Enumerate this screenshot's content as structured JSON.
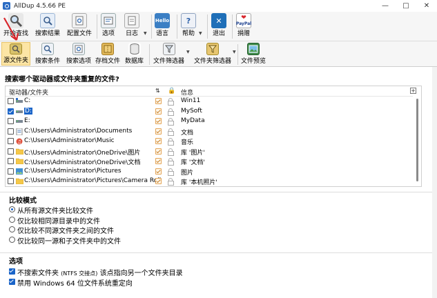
{
  "window": {
    "title": "AllDup 4.5.66 PE"
  },
  "toolbar1": {
    "start_search": "开始查找",
    "search_results": "搜索结果",
    "config_file": "配置文件",
    "options": "选项",
    "log": "日志",
    "language": "语言",
    "help": "帮助",
    "exit": "退出",
    "donate": "捐赠",
    "language_icon_text": "Hello",
    "donate_icon_text": "PayPal"
  },
  "toolbar2": {
    "source_folder": "源文件夹",
    "search_criteria": "搜索条件",
    "search_options": "搜索选项",
    "archive_files": "存档文件",
    "database": "数据库",
    "file_filter": "文件筛选器",
    "folder_filter": "文件夹筛选器",
    "file_preview": "文件预览"
  },
  "source": {
    "question": "搜索哪个驱动器或文件夹重复的文件?",
    "col_path": "驱动器/文件夹",
    "col_info": "信息",
    "rows": [
      {
        "path": "C:",
        "info": "Win11",
        "checked": false,
        "selected": false
      },
      {
        "path": "D:",
        "info": "MySoft",
        "checked": true,
        "selected": true
      },
      {
        "path": "E:",
        "info": "MyData",
        "checked": false,
        "selected": false
      },
      {
        "path": "C:\\Users\\Administrator\\Documents",
        "info": "文档",
        "checked": false,
        "selected": false
      },
      {
        "path": "C:\\Users\\Administrator\\Music",
        "info": "音乐",
        "checked": false,
        "selected": false
      },
      {
        "path": "C:\\Users\\Administrator\\OneDrive\\图片",
        "info": "库 '图片'",
        "checked": false,
        "selected": false
      },
      {
        "path": "C:\\Users\\Administrator\\OneDrive\\文档",
        "info": "库 '文档'",
        "checked": false,
        "selected": false
      },
      {
        "path": "C:\\Users\\Administrator\\Pictures",
        "info": "图片",
        "checked": false,
        "selected": false
      },
      {
        "path": "C:\\Users\\Administrator\\Pictures\\Camera Roll",
        "info": "库 '本机照片'",
        "checked": false,
        "selected": false
      }
    ]
  },
  "compare": {
    "title": "比较模式",
    "options": [
      {
        "label": "从所有源文件夹比较文件",
        "selected": true
      },
      {
        "label": "仅比较相同源目录中的文件",
        "selected": false
      },
      {
        "label": "仅比较不同源文件夹之间的文件",
        "selected": false
      },
      {
        "label": "仅比较同一源和子文件夹中的文件",
        "selected": false
      }
    ]
  },
  "options_section": {
    "title": "选项",
    "opt1_a": "不搜索文件夹",
    "opt1_b": "(NTFS 交接点)",
    "opt1_c": "该点指向另一个文件夹目录",
    "opt2": "禁用 Windows 64 位文件系统重定向"
  },
  "colors": {
    "accent": "#1a64c8",
    "active_button": "#fce5a5",
    "arrow": "#d8262c"
  }
}
